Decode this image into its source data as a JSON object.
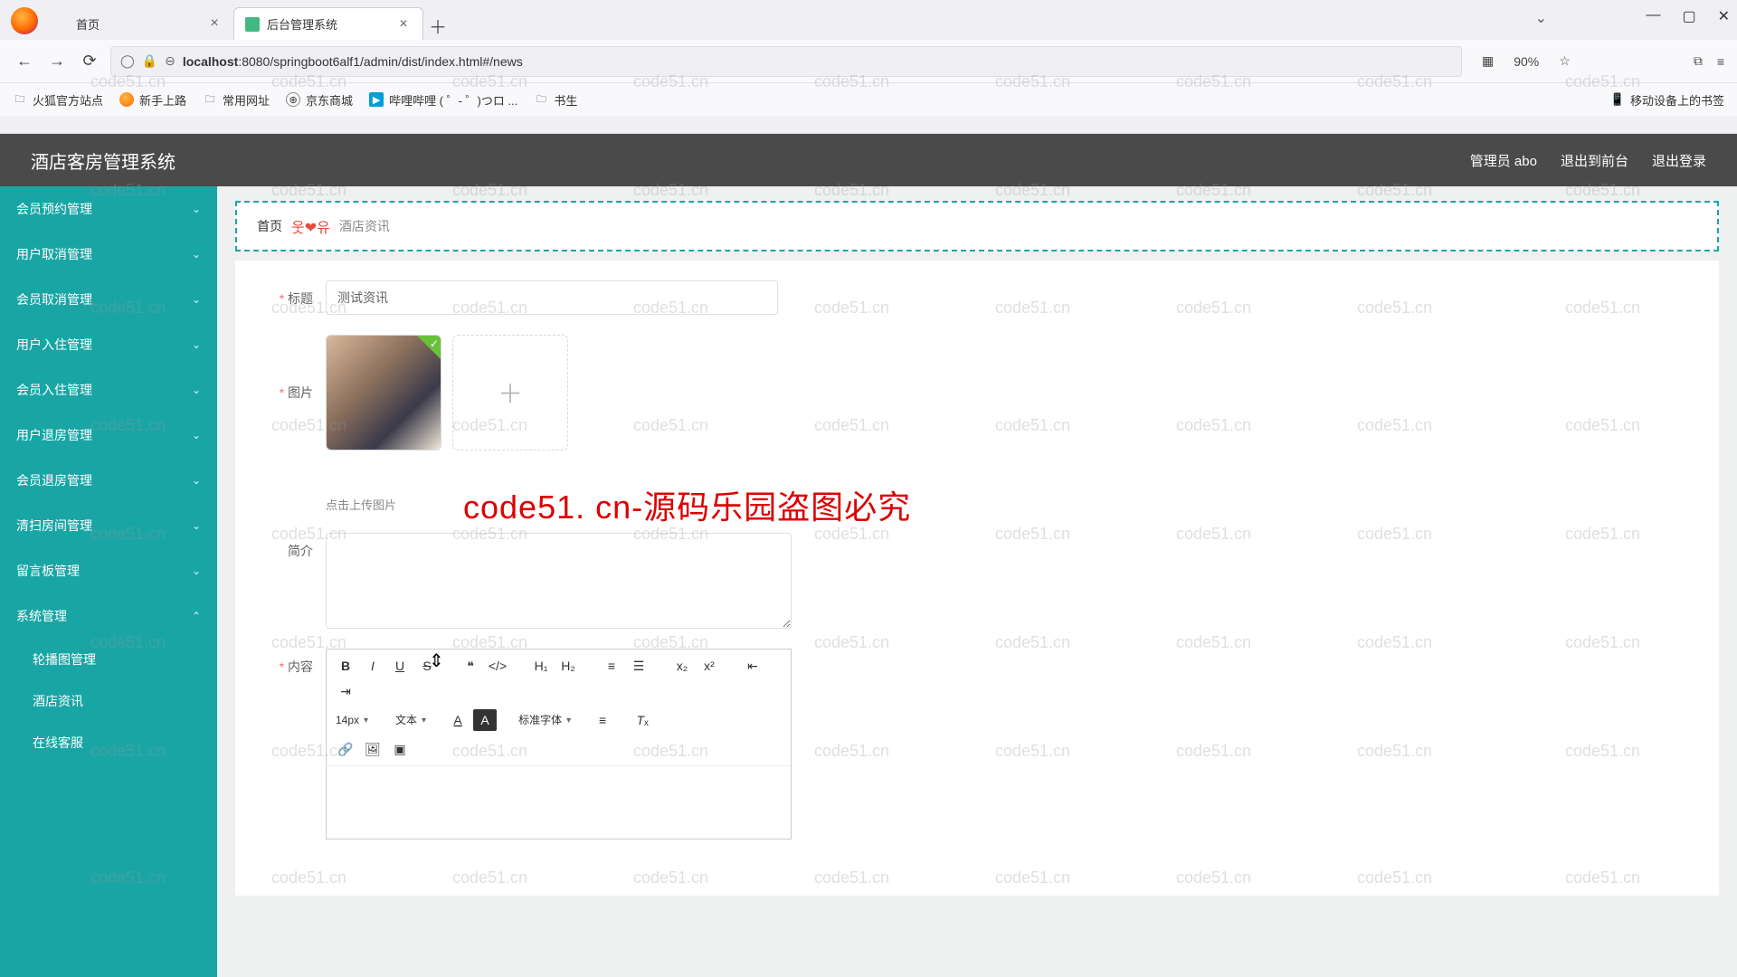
{
  "browser": {
    "tabs": [
      {
        "title": "首页",
        "active": false
      },
      {
        "title": "后台管理系统",
        "active": true
      }
    ],
    "url_host": "localhost",
    "url_port_path": ":8080/springboot6alf1/admin/dist/index.html#/news",
    "zoom": "90%",
    "bookmarks": [
      "火狐官方站点",
      "新手上路",
      "常用网址",
      "京东商城",
      "哔哩哔哩 (  ゜- ゜)つロ ...",
      "书生"
    ],
    "mobile_bm": "移动设备上的书签"
  },
  "app": {
    "title": "酒店客房管理系统",
    "admin_label": "管理员 abo",
    "exit_front": "退出到前台",
    "logout": "退出登录"
  },
  "sidebar": {
    "items": [
      "会员预约管理",
      "用户取消管理",
      "会员取消管理",
      "用户入住管理",
      "会员入住管理",
      "用户退房管理",
      "会员退房管理",
      "清扫房间管理",
      "留言板管理",
      "系统管理"
    ],
    "subs": [
      "轮播图管理",
      "酒店资讯",
      "在线客服"
    ]
  },
  "crumb": {
    "home": "首页",
    "emoji": "웃❤유",
    "page": "酒店资讯"
  },
  "form": {
    "title_label": "标题",
    "title_value": "测试资讯",
    "image_label": "图片",
    "image_hint": "点击上传图片",
    "intro_label": "简介",
    "content_label": "内容",
    "font_size": "14px",
    "text_style": "文本",
    "font_family": "标准字体"
  },
  "watermark": {
    "text": "code51.cn",
    "red": "code51. cn-源码乐园盗图必究"
  }
}
